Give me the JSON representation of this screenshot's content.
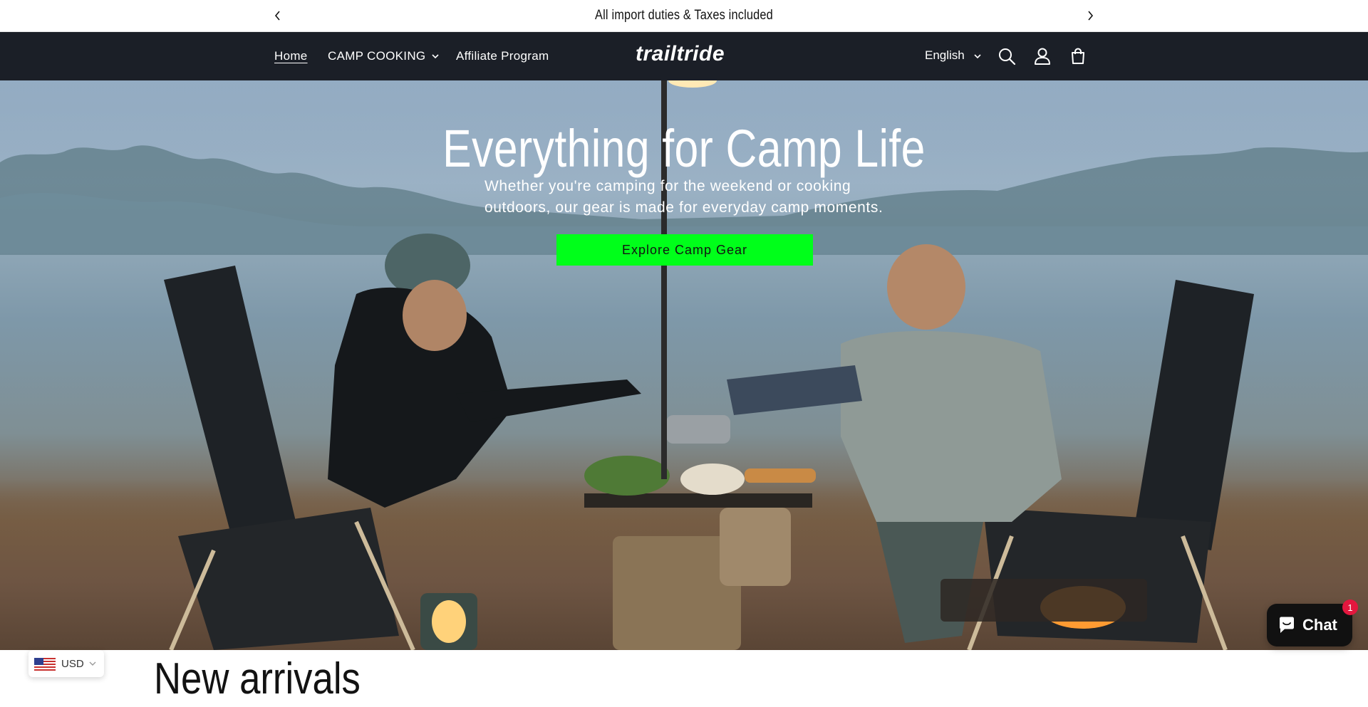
{
  "announcement": {
    "message": "All import duties & Taxes included"
  },
  "header": {
    "nav": [
      {
        "label": "Home"
      },
      {
        "label": "CAMP COOKING"
      },
      {
        "label": "Affiliate Program"
      }
    ],
    "logo": "trailtride",
    "language": "English",
    "icons": [
      "search-icon",
      "account-icon",
      "cart-icon"
    ]
  },
  "hero": {
    "title": "Everything for Camp Life",
    "subtitle": "Whether you're camping for the weekend or cooking outdoors, our gear is made for everyday camp moments.",
    "button_label": "Explore Camp Gear",
    "button_color": "#00ff1a"
  },
  "section": {
    "title": "New arrivals"
  },
  "currency": {
    "code": "USD"
  },
  "chat": {
    "label": "Chat",
    "badge_count": "1"
  },
  "colors": {
    "header_bg": "#1b1f27",
    "chat_bg": "#111111",
    "badge": "#e3173e"
  }
}
